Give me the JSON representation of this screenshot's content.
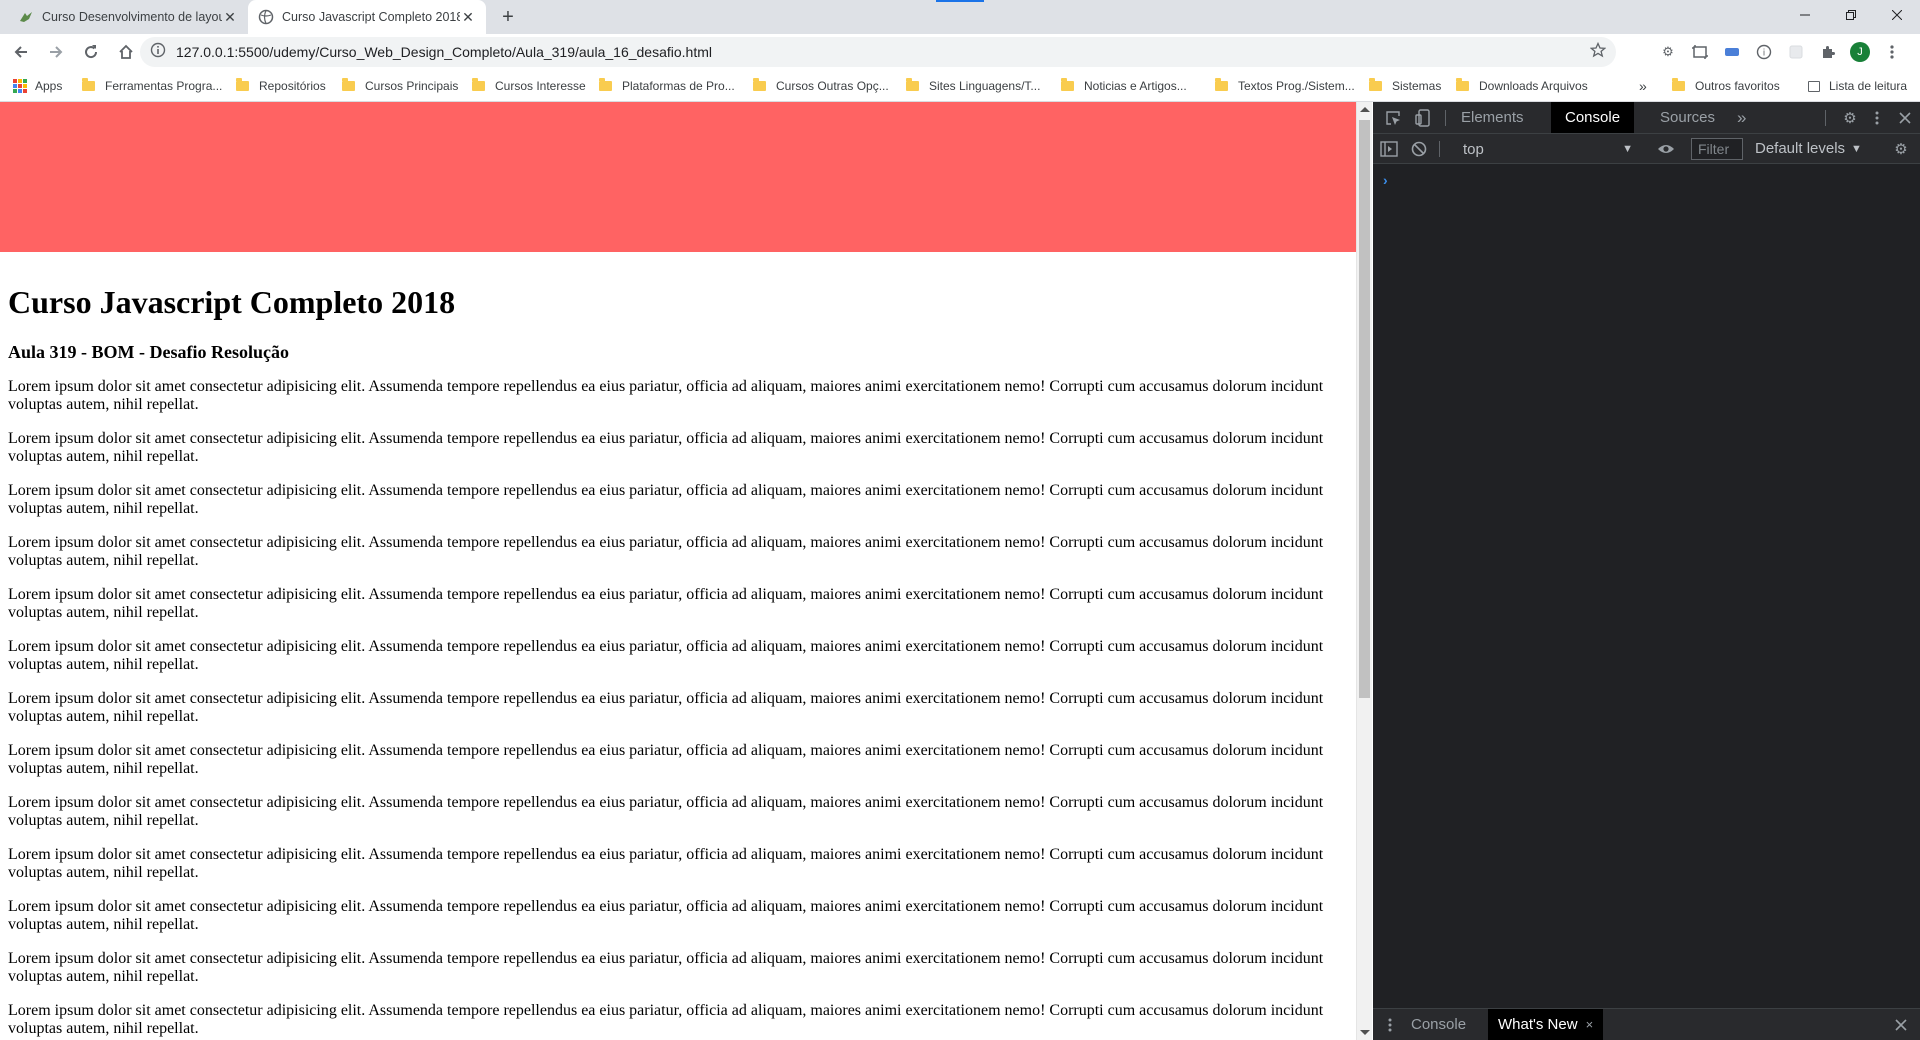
{
  "browser": {
    "tabs": [
      {
        "title": "Curso Desenvolvimento de layou",
        "active": false
      },
      {
        "title": "Curso Javascript Completo 2018",
        "active": true
      }
    ],
    "url": "127.0.0.1:5500/udemy/Curso_Web_Design_Completo/Aula_319/aula_16_desafio.html",
    "profile_initial": "J",
    "bookmarks": [
      {
        "label": "Apps",
        "icon": "apps-icon"
      },
      {
        "label": "Ferramentas Progra...",
        "icon": "folder-icon"
      },
      {
        "label": "Repositórios",
        "icon": "folder-icon"
      },
      {
        "label": "Cursos Principais",
        "icon": "folder-icon"
      },
      {
        "label": "Cursos Interesse",
        "icon": "folder-icon"
      },
      {
        "label": "Plataformas de Pro...",
        "icon": "folder-icon"
      },
      {
        "label": "Cursos Outras Opç...",
        "icon": "folder-icon"
      },
      {
        "label": "Sites Linguagens/T...",
        "icon": "folder-icon"
      },
      {
        "label": "Noticias e Artigos...",
        "icon": "folder-icon"
      },
      {
        "label": "Textos Prog./Sistem...",
        "icon": "folder-icon"
      },
      {
        "label": "Sistemas",
        "icon": "folder-icon"
      },
      {
        "label": "Downloads Arquivos",
        "icon": "folder-icon"
      }
    ],
    "bookmarks_overflow": "»",
    "other_favorites": "Outros favoritos",
    "reading_list": "Lista de leitura"
  },
  "page": {
    "header_color": "#ff6363",
    "title": "Curso Javascript Completo 2018",
    "subtitle": "Aula 319 - BOM - Desafio Resolução",
    "paragraphs": [
      "Lorem ipsum dolor sit amet consectetur adipisicing elit. Assumenda tempore repellendus ea eius pariatur, officia ad aliquam, maiores animi exercitationem nemo! Corrupti cum accusamus dolorum incidunt voluptas autem, nihil repellat.",
      "Lorem ipsum dolor sit amet consectetur adipisicing elit. Assumenda tempore repellendus ea eius pariatur, officia ad aliquam, maiores animi exercitationem nemo! Corrupti cum accusamus dolorum incidunt voluptas autem, nihil repellat.",
      "Lorem ipsum dolor sit amet consectetur adipisicing elit. Assumenda tempore repellendus ea eius pariatur, officia ad aliquam, maiores animi exercitationem nemo! Corrupti cum accusamus dolorum incidunt voluptas autem, nihil repellat.",
      "Lorem ipsum dolor sit amet consectetur adipisicing elit. Assumenda tempore repellendus ea eius pariatur, officia ad aliquam, maiores animi exercitationem nemo! Corrupti cum accusamus dolorum incidunt voluptas autem, nihil repellat.",
      "Lorem ipsum dolor sit amet consectetur adipisicing elit. Assumenda tempore repellendus ea eius pariatur, officia ad aliquam, maiores animi exercitationem nemo! Corrupti cum accusamus dolorum incidunt voluptas autem, nihil repellat.",
      "Lorem ipsum dolor sit amet consectetur adipisicing elit. Assumenda tempore repellendus ea eius pariatur, officia ad aliquam, maiores animi exercitationem nemo! Corrupti cum accusamus dolorum incidunt voluptas autem, nihil repellat.",
      "Lorem ipsum dolor sit amet consectetur adipisicing elit. Assumenda tempore repellendus ea eius pariatur, officia ad aliquam, maiores animi exercitationem nemo! Corrupti cum accusamus dolorum incidunt voluptas autem, nihil repellat.",
      "Lorem ipsum dolor sit amet consectetur adipisicing elit. Assumenda tempore repellendus ea eius pariatur, officia ad aliquam, maiores animi exercitationem nemo! Corrupti cum accusamus dolorum incidunt voluptas autem, nihil repellat.",
      "Lorem ipsum dolor sit amet consectetur adipisicing elit. Assumenda tempore repellendus ea eius pariatur, officia ad aliquam, maiores animi exercitationem nemo! Corrupti cum accusamus dolorum incidunt voluptas autem, nihil repellat.",
      "Lorem ipsum dolor sit amet consectetur adipisicing elit. Assumenda tempore repellendus ea eius pariatur, officia ad aliquam, maiores animi exercitationem nemo! Corrupti cum accusamus dolorum incidunt voluptas autem, nihil repellat.",
      "Lorem ipsum dolor sit amet consectetur adipisicing elit. Assumenda tempore repellendus ea eius pariatur, officia ad aliquam, maiores animi exercitationem nemo! Corrupti cum accusamus dolorum incidunt voluptas autem, nihil repellat.",
      "Lorem ipsum dolor sit amet consectetur adipisicing elit. Assumenda tempore repellendus ea eius pariatur, officia ad aliquam, maiores animi exercitationem nemo! Corrupti cum accusamus dolorum incidunt voluptas autem, nihil repellat.",
      "Lorem ipsum dolor sit amet consectetur adipisicing elit. Assumenda tempore repellendus ea eius pariatur, officia ad aliquam, maiores animi exercitationem nemo! Corrupti cum accusamus dolorum incidunt voluptas autem, nihil repellat."
    ]
  },
  "devtools": {
    "tabs": [
      "Elements",
      "Console",
      "Sources"
    ],
    "selected_tab": "Console",
    "more_tabs": "»",
    "context": "top",
    "filter_placeholder": "Filter",
    "levels": "Default levels",
    "prompt": "›",
    "drawer_tabs": [
      "Console",
      "What's New"
    ],
    "drawer_selected": "What's New",
    "drawer_close": "×"
  }
}
